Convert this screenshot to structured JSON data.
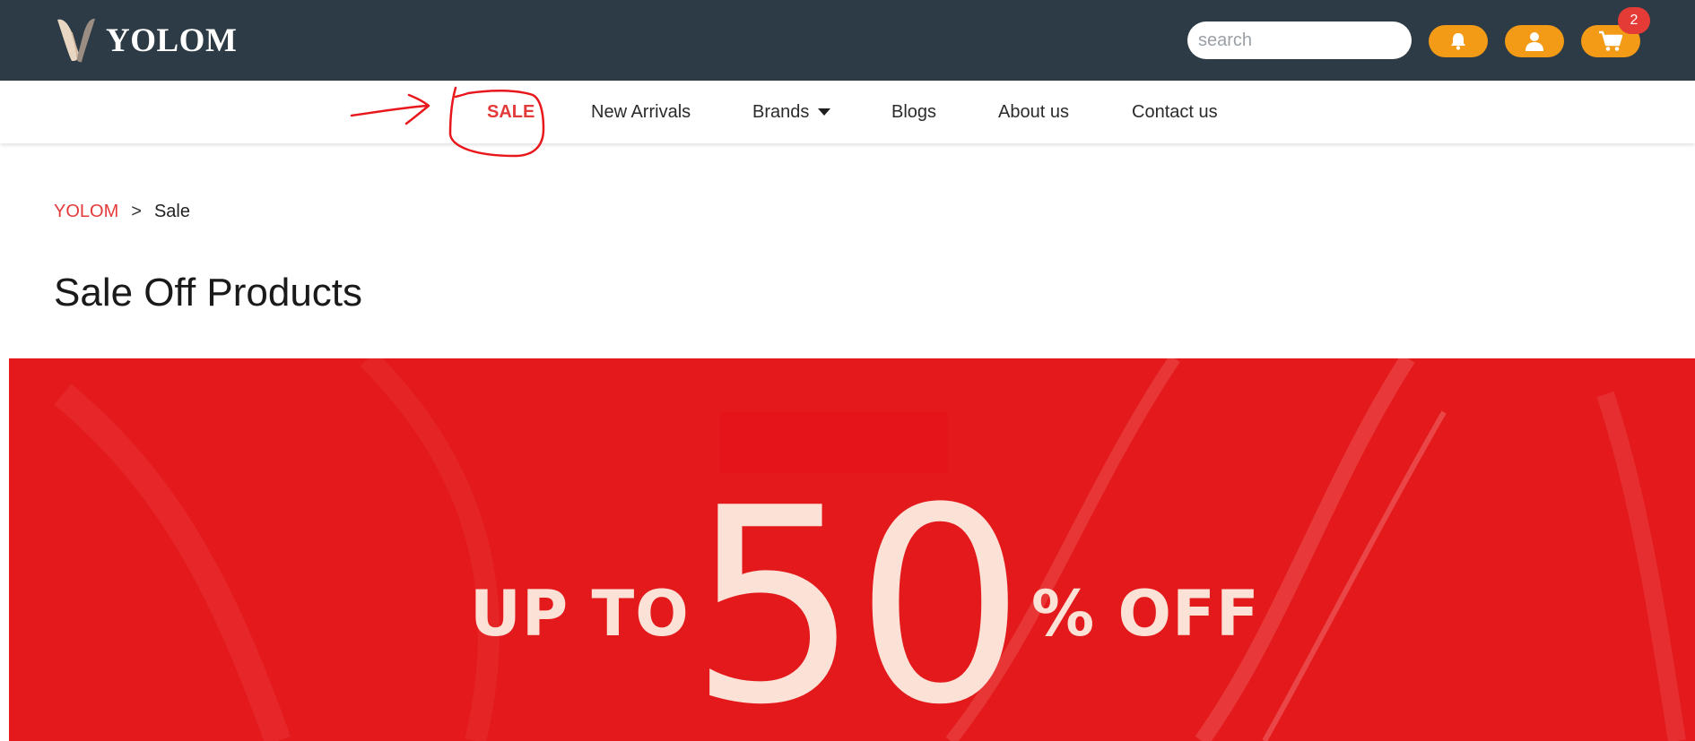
{
  "header": {
    "brand_name": "YOLOM",
    "search": {
      "placeholder": "search",
      "value": ""
    },
    "cart_count": "2",
    "colors": {
      "background": "#2c3b45",
      "pill_buttons": "#f39a16",
      "badge": "#e53b37"
    },
    "icons": [
      "logo-icon",
      "search-icon",
      "bell-icon",
      "user-icon",
      "cart-icon"
    ]
  },
  "nav": {
    "items": [
      {
        "label": "SALE",
        "active": true
      },
      {
        "label": "New Arrivals"
      },
      {
        "label": "Brands",
        "has_dropdown": true
      },
      {
        "label": "Blogs"
      },
      {
        "label": "About us"
      },
      {
        "label": "Contact us"
      }
    ],
    "active_color": "#e33b3b"
  },
  "breadcrumb": {
    "home": "YOLOM",
    "separator": ">",
    "current": "Sale"
  },
  "page": {
    "title": "Sale Off Products"
  },
  "banner": {
    "prefix": "UP TO",
    "number": "50",
    "suffix": "% OFF",
    "background_color": "#e3191b",
    "text_color": "#fbe1d6"
  },
  "annotation": {
    "color": "#e8171c",
    "shapes": [
      "arrow",
      "circle"
    ]
  }
}
